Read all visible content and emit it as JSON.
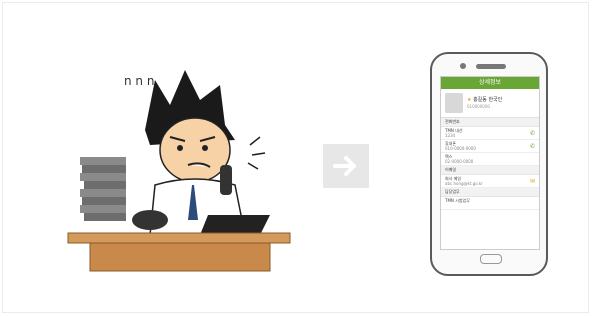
{
  "phone": {
    "app_title": "상세정보",
    "contact_name": "홍길동 한국인",
    "contact_sub": "010000000",
    "sections": [
      {
        "header": "전화번호",
        "rows": [
          {
            "label": "TMN 내선",
            "value": "1234",
            "icon": "phone-icon"
          },
          {
            "label": "휴대폰",
            "value": "010-0000-0000",
            "icon": "phone-icon"
          },
          {
            "label": "팩스",
            "value": "02-0000-0000",
            "icon": "none"
          }
        ]
      },
      {
        "header": "이메일",
        "rows": [
          {
            "label": "회사 메일",
            "value": "abc.hong@kt.go.kr",
            "icon": "mail-icon"
          }
        ]
      },
      {
        "header": "담당업무",
        "rows": [
          {
            "label": "TMN 시범업무",
            "value": "",
            "icon": "none"
          }
        ]
      }
    ]
  },
  "colors": {
    "appbar": "#6aa636",
    "arrow_box": "#e7e7e7",
    "desk": "#c8894a"
  },
  "illustration": {
    "subject": "stressed-office-worker-on-phone"
  }
}
